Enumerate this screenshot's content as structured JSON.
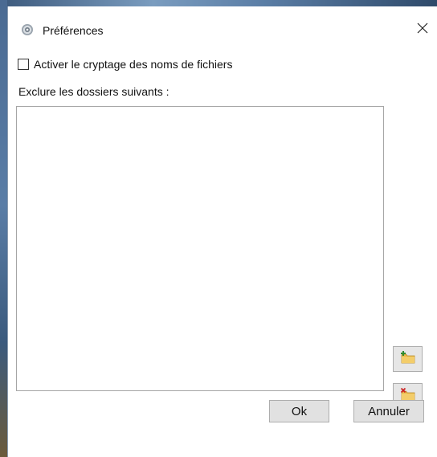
{
  "window": {
    "title": "Préférences",
    "icon": "gear-icon",
    "close_icon": "close-icon"
  },
  "options": {
    "encrypt_filenames_label": "Activer le cryptage des noms de fichiers",
    "encrypt_filenames_checked": false
  },
  "exclude": {
    "label": "Exclure les dossiers suivants :",
    "folders": [],
    "add_icon": "folder-add-icon",
    "remove_icon": "folder-remove-icon"
  },
  "buttons": {
    "ok": "Ok",
    "cancel": "Annuler"
  },
  "colors": {
    "button_face": "#e1e1e1",
    "button_border": "#adadad",
    "folder": "#e8b84a",
    "add_accent": "#2e8b2e",
    "remove_accent": "#cc2222"
  }
}
